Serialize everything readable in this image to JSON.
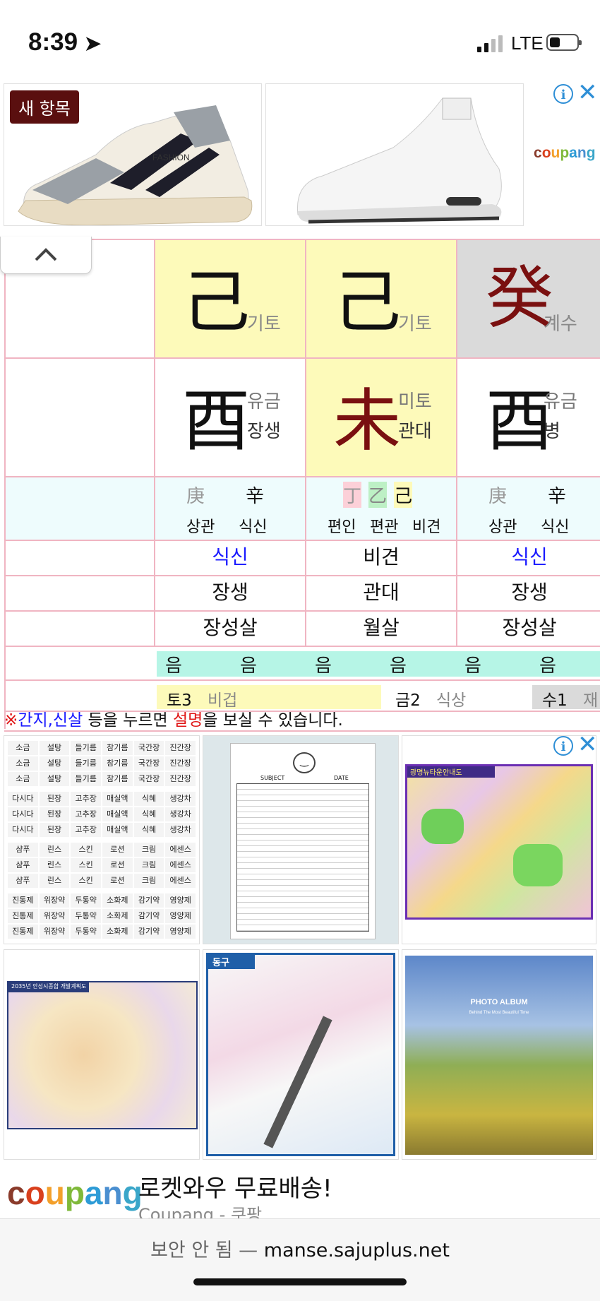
{
  "status_bar": {
    "time": "8:39",
    "network": "LTE"
  },
  "top_ad": {
    "badge": "새 항목",
    "shoe1_label": "FASHION",
    "brand": "coupang"
  },
  "saju": {
    "stems": [
      {
        "char": "己",
        "label": "기토"
      },
      {
        "char": "己",
        "label": "기토"
      },
      {
        "char": "癸",
        "label": "계수"
      }
    ],
    "branches": [
      {
        "char": "酉",
        "label1": "유금",
        "label2": "장생"
      },
      {
        "char": "未",
        "label1": "미토",
        "label2": "관대"
      },
      {
        "char": "酉",
        "label1": "유금",
        "label2": "병"
      }
    ],
    "hidden": [
      {
        "chars": [
          "庚",
          "辛"
        ],
        "gods": [
          "상관",
          "식신"
        ]
      },
      {
        "chars": [
          "丁",
          "乙",
          "己"
        ],
        "gods": [
          "편인",
          "편관",
          "비견"
        ]
      },
      {
        "chars": [
          "庚",
          "辛"
        ],
        "gods": [
          "상관",
          "식신"
        ]
      }
    ],
    "ten_gods": [
      "식신",
      "비견",
      "식신"
    ],
    "twelve_states": [
      "장생",
      "관대",
      "장생"
    ],
    "spirits": [
      "장성살",
      "월살",
      "장성살"
    ],
    "yin_yang": [
      "음",
      "음",
      "음",
      "음",
      "음",
      "음"
    ],
    "elements": [
      {
        "name": "토3",
        "state": "비겁"
      },
      {
        "name": "금2",
        "state": "식상"
      },
      {
        "name": "수1",
        "state": "재"
      }
    ]
  },
  "notice": {
    "mark": "※",
    "ganji": "간지,신살",
    "mid": " 등을 누르면 ",
    "explain": "설명",
    "end": "을 보실 수 있습니다."
  },
  "grid_ad": {
    "spice_rows": [
      [
        "소금",
        "설탕",
        "들기름",
        "참기름",
        "국간장",
        "진간장"
      ],
      [
        "소금",
        "설탕",
        "들기름",
        "참기름",
        "국간장",
        "진간장"
      ],
      [
        "소금",
        "설탕",
        "들기름",
        "참기름",
        "국간장",
        "진간장"
      ],
      [
        "다시다",
        "된장",
        "고추장",
        "매실액",
        "식혜",
        "생강차"
      ],
      [
        "다시다",
        "된장",
        "고추장",
        "매실액",
        "식혜",
        "생강차"
      ],
      [
        "다시다",
        "된장",
        "고추장",
        "매실액",
        "식혜",
        "생강차"
      ],
      [
        "샴푸",
        "린스",
        "스킨",
        "로션",
        "크림",
        "에센스"
      ],
      [
        "샴푸",
        "린스",
        "스킨",
        "로션",
        "크림",
        "에센스"
      ],
      [
        "샴푸",
        "린스",
        "스킨",
        "로션",
        "크림",
        "에센스"
      ],
      [
        "진통제",
        "위장약",
        "두통약",
        "소화제",
        "감기약",
        "영양제"
      ],
      [
        "진통제",
        "위장약",
        "두통약",
        "소화제",
        "감기약",
        "영양제"
      ],
      [
        "진통제",
        "위장약",
        "두통약",
        "소화제",
        "감기약",
        "영양제"
      ]
    ],
    "doc_subject": "SUBJECT",
    "doc_date": "DATE",
    "map1_title": "광명뉴타운안내도",
    "map2_title": "2035년 안성시종합 개발계획도",
    "map3_title": "동구",
    "album_title": "PHOTO ALBUM",
    "album_sub": "Behind The Most Beautiful Time"
  },
  "bottom_ad": {
    "brand": "coupang",
    "title": "로켓와우 무료배송!",
    "subtitle": "Coupang - 쿠팡"
  },
  "address_bar": {
    "insecure": "보안 안 됨 — ",
    "domain": "manse.sajuplus.net"
  }
}
